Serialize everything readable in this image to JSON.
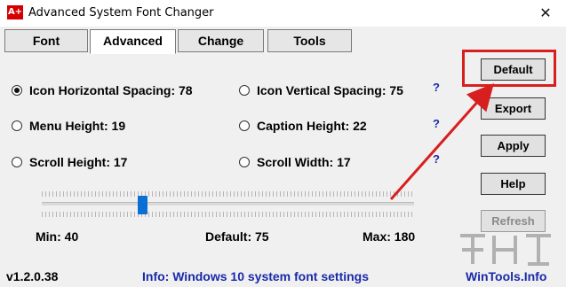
{
  "window": {
    "title": "Advanced System Font Changer",
    "icon_text": "A+",
    "close_glyph": "✕"
  },
  "tabs": [
    {
      "label": "Font",
      "active": false
    },
    {
      "label": "Advanced",
      "active": true
    },
    {
      "label": "Change",
      "active": false
    },
    {
      "label": "Tools",
      "active": false
    }
  ],
  "options": [
    {
      "label": "Icon Horizontal Spacing: 78",
      "checked": true
    },
    {
      "label": "Icon Vertical Spacing: 75",
      "checked": false
    },
    {
      "label": "Menu Height: 19",
      "checked": false
    },
    {
      "label": "Caption Height: 22",
      "checked": false
    },
    {
      "label": "Scroll Height: 17",
      "checked": false
    },
    {
      "label": "Scroll Width: 17",
      "checked": false
    }
  ],
  "help": [
    "?",
    "?",
    "?"
  ],
  "buttons": {
    "default": "Default",
    "export": "Export",
    "apply": "Apply",
    "help": "Help",
    "refresh": "Refresh"
  },
  "slider": {
    "min_label": "Min: 40",
    "default_label": "Default: 75",
    "max_label": "Max: 180",
    "min": 40,
    "max": 180,
    "value": 78
  },
  "status": {
    "version": "v1.2.0.38",
    "info": "Info: Windows 10 system font settings",
    "site": "WinTools.Info"
  },
  "colors": {
    "link_blue": "#1a2aa8",
    "highlight_red": "#d81f1f",
    "thumb_blue": "#0a6fd4"
  }
}
